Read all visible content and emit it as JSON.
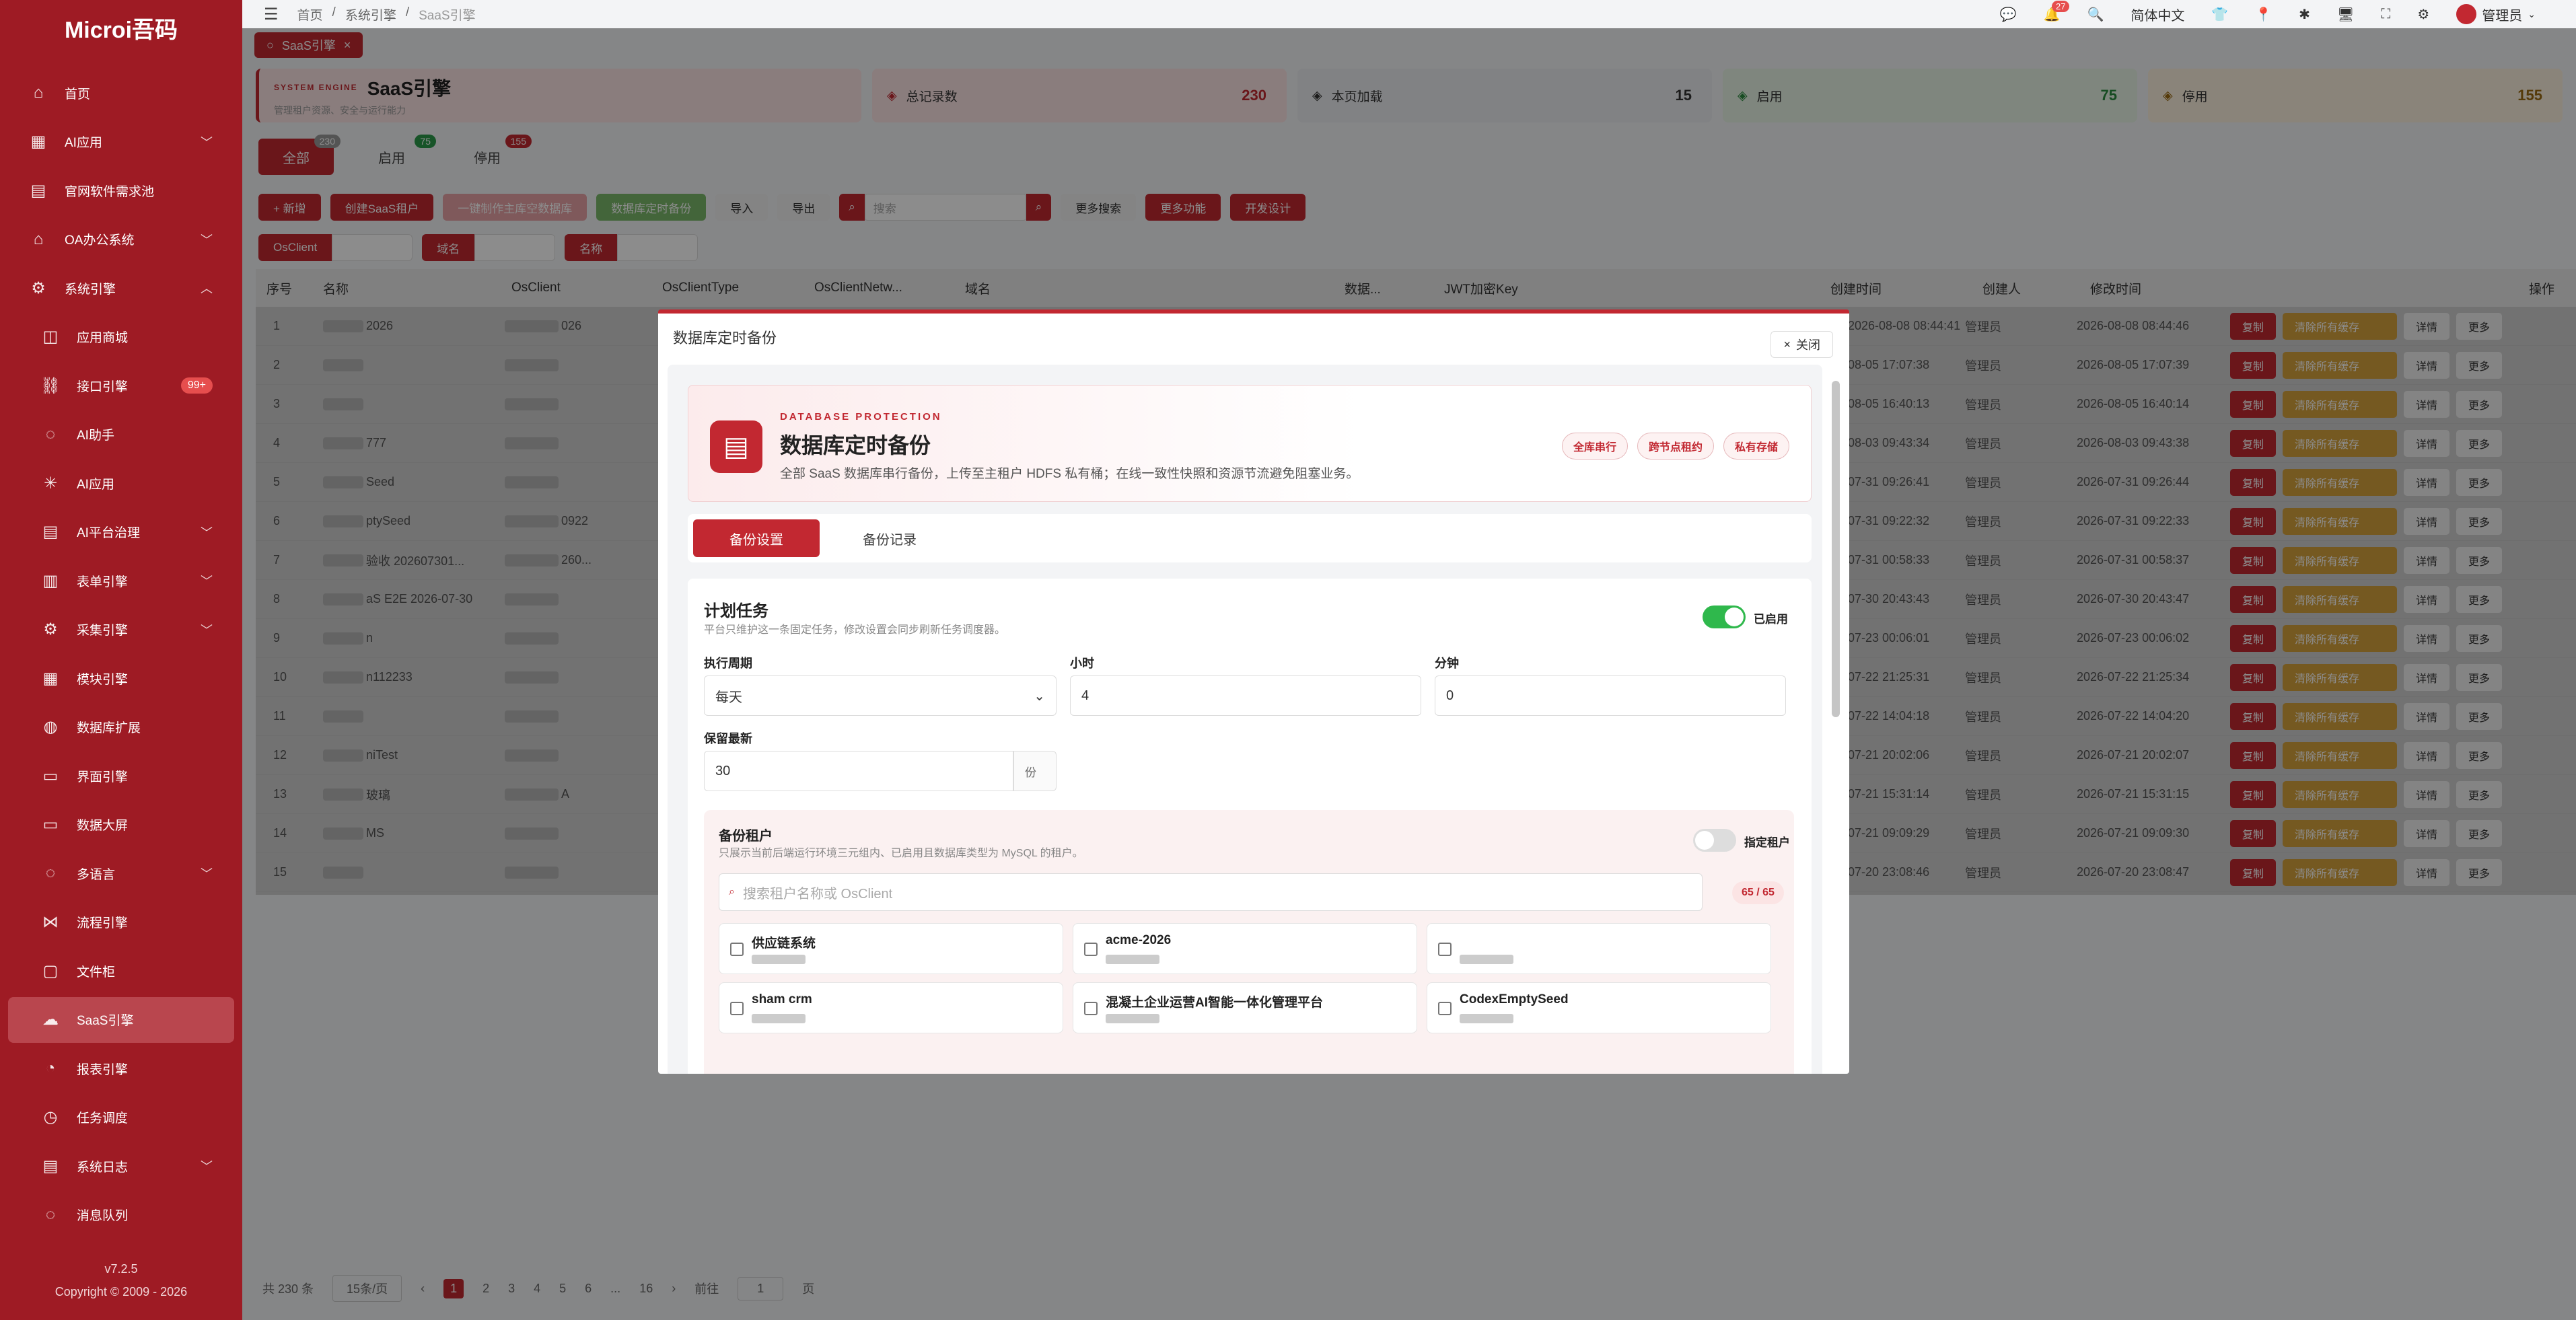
{
  "app": {
    "title": "Microi吾码",
    "version": "v7.2.5",
    "copyright": "Copyright © 2009 - 2026"
  },
  "sidebar": {
    "items": [
      {
        "label": "首页",
        "icon": "home-icon",
        "chev": false,
        "sub": false
      },
      {
        "label": "AI应用",
        "icon": "grid-icon",
        "chev": true,
        "sub": false
      },
      {
        "label": "官网软件需求池",
        "icon": "doc-icon",
        "chev": false,
        "sub": false
      },
      {
        "label": "OA办公系统",
        "icon": "home-icon",
        "chev": true,
        "sub": false
      },
      {
        "label": "系统引擎",
        "icon": "gear-icon",
        "chev": true,
        "sub": false,
        "open": true
      },
      {
        "label": "应用商城",
        "icon": "bag-icon",
        "chev": false,
        "sub": true
      },
      {
        "label": "接口引擎",
        "icon": "link-icon",
        "chev": false,
        "sub": true,
        "badge": "99+"
      },
      {
        "label": "AI助手",
        "icon": "chat-icon",
        "chev": false,
        "sub": true
      },
      {
        "label": "AI应用",
        "icon": "sun-icon",
        "chev": false,
        "sub": true
      },
      {
        "label": "AI平台治理",
        "icon": "doc-icon",
        "chev": true,
        "sub": true
      },
      {
        "label": "表单引擎",
        "icon": "table-icon",
        "chev": true,
        "sub": true
      },
      {
        "label": "采集引擎",
        "icon": "gear-icon",
        "chev": true,
        "sub": true
      },
      {
        "label": "模块引擎",
        "icon": "grid-icon",
        "chev": false,
        "sub": true
      },
      {
        "label": "数据库扩展",
        "icon": "db-icon",
        "chev": false,
        "sub": true
      },
      {
        "label": "界面引擎",
        "icon": "screen-icon",
        "chev": false,
        "sub": true
      },
      {
        "label": "数据大屏",
        "icon": "screen-icon",
        "chev": false,
        "sub": true
      },
      {
        "label": "多语言",
        "icon": "chat-icon",
        "chev": true,
        "sub": true
      },
      {
        "label": "流程引擎",
        "icon": "share-icon",
        "chev": false,
        "sub": true
      },
      {
        "label": "文件柜",
        "icon": "folder-icon",
        "chev": false,
        "sub": true
      },
      {
        "label": "SaaS引擎",
        "icon": "cloud-icon",
        "chev": false,
        "sub": true,
        "active": true
      },
      {
        "label": "报表引擎",
        "icon": "chart-icon",
        "chev": false,
        "sub": true
      },
      {
        "label": "任务调度",
        "icon": "clock-icon",
        "chev": false,
        "sub": true
      },
      {
        "label": "系统日志",
        "icon": "doc-icon",
        "chev": true,
        "sub": true
      },
      {
        "label": "消息队列",
        "icon": "chat-icon",
        "chev": false,
        "sub": true
      }
    ]
  },
  "topbar": {
    "crumbs": [
      "首页",
      "/",
      "系统引擎",
      "/",
      "SaaS引擎"
    ],
    "lang": "简体中文",
    "user": "管理员",
    "notif": "27"
  },
  "tag": {
    "label": "SaaS引擎",
    "close": "×"
  },
  "banner": {
    "engine_kicker": "SYSTEM ENGINE",
    "engine_title": "SaaS引擎",
    "engine_sub": "管理租户资源、安全与运行能力",
    "stats": [
      {
        "label": "总记录数",
        "value": "230",
        "color": "#fbe4e4",
        "vcolor": "#c22831"
      },
      {
        "label": "本页加载",
        "value": "15",
        "color": "#ebedf0",
        "vcolor": "#333"
      },
      {
        "label": "启用",
        "value": "75",
        "color": "#e7f5e6",
        "vcolor": "#2b8a3e"
      },
      {
        "label": "停用",
        "value": "155",
        "color": "#fbf1df",
        "vcolor": "#9c6a12"
      }
    ]
  },
  "tabs": [
    {
      "label": "全部",
      "count": "230",
      "active": true,
      "color": "#9a9a9a"
    },
    {
      "label": "启用",
      "count": "75",
      "color": "#2b9a4a"
    },
    {
      "label": "停用",
      "count": "155",
      "color": "#c22831"
    }
  ],
  "toolbar": {
    "buttons": [
      {
        "label": "+ 新增",
        "bg": "#c22831"
      },
      {
        "label": "创建SaaS租户",
        "bg": "#c22831"
      },
      {
        "label": "一键制作主库空数据库",
        "bg": "#e7a3a6"
      },
      {
        "label": "数据库定时备份",
        "bg": "#7ab86a"
      },
      {
        "label": "导入",
        "bg": "#f0f0f0"
      },
      {
        "label": "导出",
        "bg": "#f0f0f0"
      }
    ],
    "search_placeholder": "搜索",
    "more_search": "更多搜索",
    "more_func": "更多功能",
    "dev": "开发设计"
  },
  "filters": [
    "OsClient",
    "域名",
    "名称"
  ],
  "table": {
    "headers": [
      "序号",
      "名称",
      "OsClient",
      "OsClientType",
      "OsClientNetw...",
      "域名",
      "数据...",
      "JWT加密Key",
      "创建时间",
      "创建人",
      "修改时间",
      "操作"
    ],
    "rows": [
      {
        "idx": "1",
        "name": "2026",
        "osc": "026",
        "ct": "2026-08-08 08:44:41",
        "mt": "2026-08-08 08:44:46"
      },
      {
        "idx": "2",
        "name": "",
        "osc": "",
        "ct": "08-05 17:07:38",
        "mt": "2026-08-05 17:07:39"
      },
      {
        "idx": "3",
        "name": "",
        "osc": "",
        "ct": "08-05 16:40:13",
        "mt": "2026-08-05 16:40:14"
      },
      {
        "idx": "4",
        "name": "777",
        "osc": "",
        "ct": "08-03 09:43:34",
        "mt": "2026-08-03 09:43:38"
      },
      {
        "idx": "5",
        "name": "Seed",
        "osc": "",
        "ct": "07-31 09:26:41",
        "mt": "2026-07-31 09:26:44"
      },
      {
        "idx": "6",
        "name": "ptySeed",
        "osc": "0922",
        "ct": "07-31 09:22:32",
        "mt": "2026-07-31 09:22:33"
      },
      {
        "idx": "7",
        "name": "验收 202607301...",
        "osc": "260...",
        "ct": "07-31 00:58:33",
        "mt": "2026-07-31 00:58:37"
      },
      {
        "idx": "8",
        "name": "aS E2E 2026-07-30",
        "osc": "",
        "ct": "07-30 20:43:43",
        "mt": "2026-07-30 20:43:47"
      },
      {
        "idx": "9",
        "name": "n",
        "osc": "",
        "ct": "07-23 00:06:01",
        "mt": "2026-07-23 00:06:02"
      },
      {
        "idx": "10",
        "name": "n112233",
        "osc": "",
        "ct": "07-22 21:25:31",
        "mt": "2026-07-22 21:25:34"
      },
      {
        "idx": "11",
        "name": "",
        "osc": "",
        "ct": "07-22 14:04:18",
        "mt": "2026-07-22 14:04:20"
      },
      {
        "idx": "12",
        "name": "niTest",
        "osc": "",
        "ct": "07-21 20:02:06",
        "mt": "2026-07-21 20:02:07"
      },
      {
        "idx": "13",
        "name": "玻璃",
        "osc": "A",
        "ct": "07-21 15:31:14",
        "mt": "2026-07-21 15:31:15"
      },
      {
        "idx": "14",
        "name": "MS",
        "osc": "",
        "ct": "07-21 09:09:29",
        "mt": "2026-07-21 09:09:30"
      },
      {
        "idx": "15",
        "name": "",
        "osc": "",
        "ct": "07-20 23:08:46",
        "mt": "2026-07-20 23:08:47"
      }
    ],
    "creator": "管理员",
    "op_copy": "复制",
    "op_clear": "清除所有缓存",
    "op_detail": "详情",
    "op_more": "更多"
  },
  "pager": {
    "total": "共 230 条",
    "size": "15条/页",
    "pages": [
      "1",
      "2",
      "3",
      "4",
      "5",
      "6",
      "...",
      "16"
    ],
    "goto": "前往",
    "goto_val": "1",
    "page_unit": "页"
  },
  "modal": {
    "title": "数据库定时备份",
    "close": "关闭",
    "hero": {
      "kicker": "DATABASE PROTECTION",
      "title": "数据库定时备份",
      "desc": "全部 SaaS 数据库串行备份，上传至主租户 HDFS 私有桶；在线一致性快照和资源节流避免阻塞业务。",
      "chips": [
        "全库串行",
        "跨节点租约",
        "私有存储"
      ]
    },
    "tabs": [
      "备份设置",
      "备份记录"
    ],
    "plan": {
      "title": "计划任务",
      "desc": "平台只维护这一条固定任务，修改设置会同步刷新任务调度器。",
      "enabled_label": "已启用",
      "period_label": "执行周期",
      "period": "每天",
      "hour_label": "小时",
      "hour": "4",
      "minute_label": "分钟",
      "minute": "0",
      "keep_label": "保留最新",
      "keep": "30",
      "keep_unit": "份"
    },
    "tenants": {
      "title": "备份租户",
      "desc": "只展示当前后端运行环境三元组内、已启用且数据库类型为 MySQL 的租户。",
      "specify_label": "指定租户",
      "search_placeholder": "搜索租户名称或 OsClient",
      "count": "65 / 65",
      "items": [
        "供应链系统",
        "acme-2026",
        "",
        "sham crm",
        "混凝土企业运营AI智能一体化管理平台",
        "CodexEmptySeed"
      ]
    }
  }
}
